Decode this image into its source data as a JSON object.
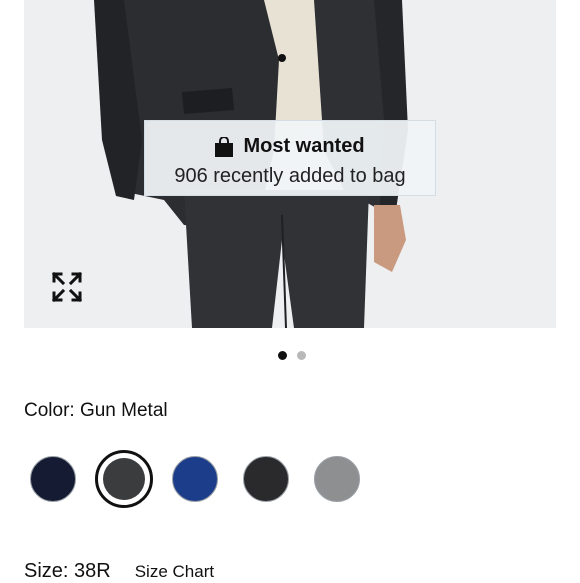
{
  "product_image": {
    "alt_hint": "man in gun metal suit",
    "badge": {
      "icon": "shopping-bag-icon",
      "title": "Most wanted",
      "subtitle": "906 recently added to bag"
    },
    "expand_icon": "expand-arrows-icon"
  },
  "carousel": {
    "total": 2,
    "active_index": 0
  },
  "color": {
    "label": "Color: Gun Metal",
    "swatches": [
      {
        "name": "Navy",
        "hex": "#141b33",
        "selected": false
      },
      {
        "name": "Gun Metal",
        "hex": "#3b3c3e",
        "selected": true
      },
      {
        "name": "Blue",
        "hex": "#1c3d8a",
        "selected": false
      },
      {
        "name": "Charcoal",
        "hex": "#2a2a2c",
        "selected": false
      },
      {
        "name": "Grey",
        "hex": "#8e8f91",
        "selected": false
      }
    ]
  },
  "size": {
    "label": "Size: 38R",
    "chart_link": "Size Chart"
  }
}
